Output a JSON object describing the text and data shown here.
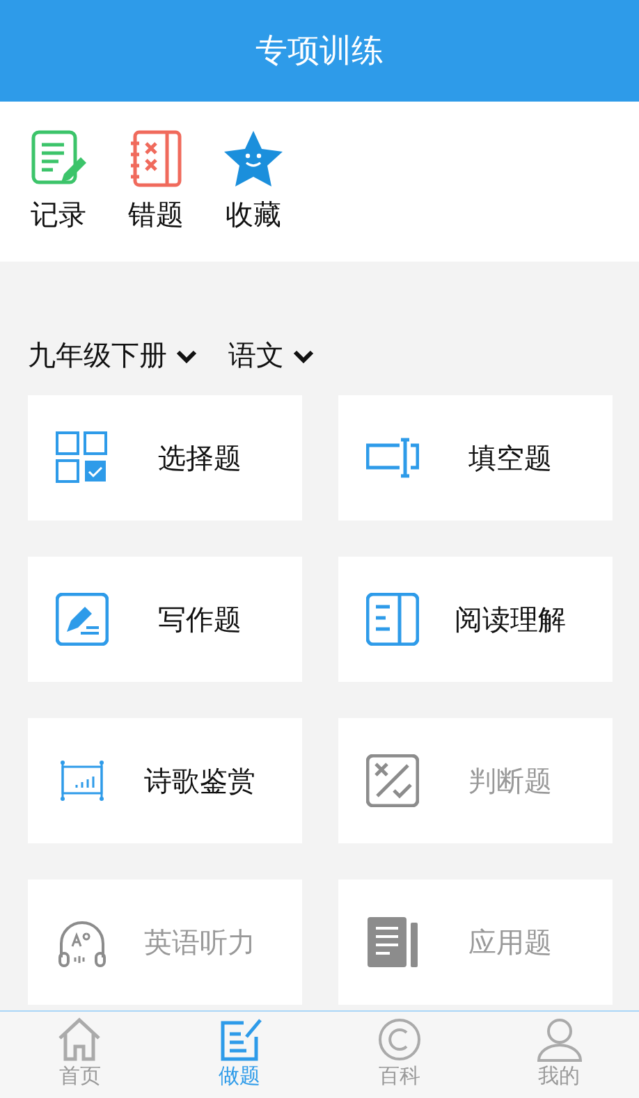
{
  "header": {
    "title": "专项训练"
  },
  "shortcuts": [
    {
      "kind": "record",
      "label": "记录"
    },
    {
      "kind": "mistakes",
      "label": "错题"
    },
    {
      "kind": "favorites",
      "label": "收藏"
    }
  ],
  "filters": [
    {
      "label": "九年级下册"
    },
    {
      "label": "语文"
    }
  ],
  "cards": [
    {
      "kind": "choice",
      "label": "选择题",
      "disabled": false
    },
    {
      "kind": "blank",
      "label": "填空题",
      "disabled": false
    },
    {
      "kind": "writing",
      "label": "写作题",
      "disabled": false
    },
    {
      "kind": "reading",
      "label": "阅读理解",
      "disabled": false
    },
    {
      "kind": "poetry",
      "label": "诗歌鉴赏",
      "disabled": false
    },
    {
      "kind": "judge",
      "label": "判断题",
      "disabled": true
    },
    {
      "kind": "listening",
      "label": "英语听力",
      "disabled": true
    },
    {
      "kind": "application",
      "label": "应用题",
      "disabled": true
    }
  ],
  "tabbar": [
    {
      "kind": "home",
      "label": "首页",
      "selected": false
    },
    {
      "kind": "practice",
      "label": "做题",
      "selected": true
    },
    {
      "kind": "wiki",
      "label": "百科",
      "selected": false
    },
    {
      "kind": "me",
      "label": "我的",
      "selected": false
    }
  ]
}
